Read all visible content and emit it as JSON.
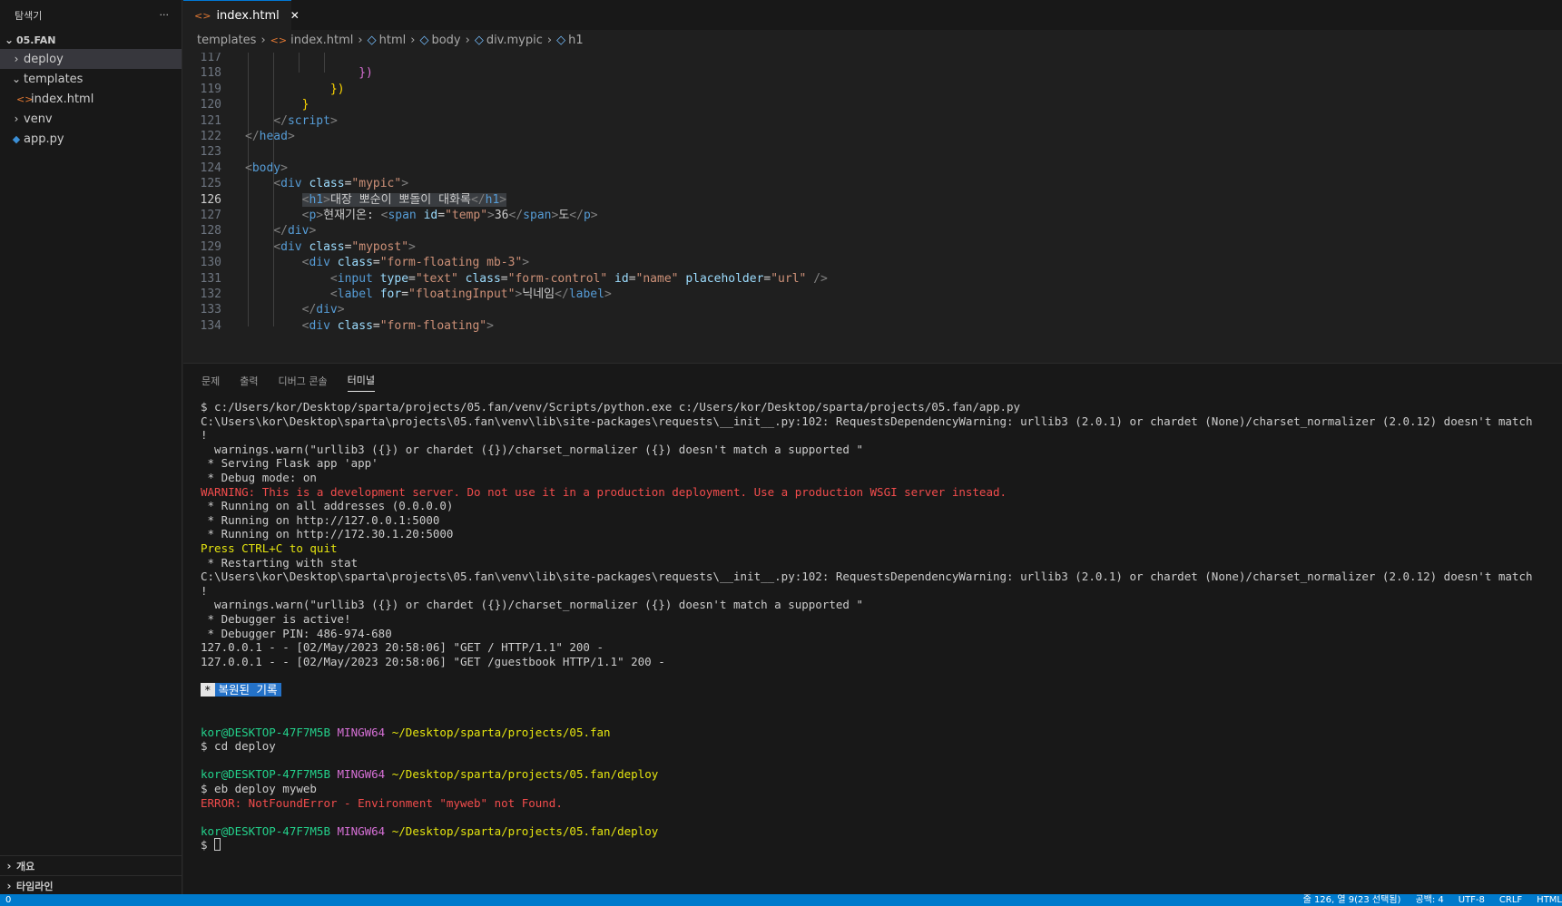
{
  "explorer": {
    "title": "탐색기",
    "more": "···",
    "project": "05.FAN",
    "items": [
      {
        "label": "deploy",
        "type": "folder",
        "icon": "chevron-right-icon"
      },
      {
        "label": "templates",
        "type": "folder-open",
        "icon": "chevron-down-icon"
      },
      {
        "label": "index.html",
        "type": "html-file",
        "icon": "html-file-icon"
      },
      {
        "label": "venv",
        "type": "folder",
        "icon": "chevron-right-icon"
      },
      {
        "label": "app.py",
        "type": "python-file",
        "icon": "python-file-icon"
      }
    ],
    "outline": "개요",
    "timeline": "타임라인"
  },
  "tab": {
    "label": "index.html",
    "close": "✕"
  },
  "breadcrumb": [
    "templates",
    "index.html",
    "html",
    "body",
    "div.mypic",
    "h1"
  ],
  "editor": {
    "lines": [
      {
        "n": "117",
        "html": ""
      },
      {
        "n": "118",
        "html": "                <span class='t-p'>})</span>"
      },
      {
        "n": "119",
        "html": "            <span class='t-y'>})</span>"
      },
      {
        "n": "120",
        "html": "        <span class='t-y'>}</span>"
      },
      {
        "n": "121",
        "html": "    <span class='t-br'>&lt;/</span><span class='t-tag'>script</span><span class='t-br'>&gt;</span>"
      },
      {
        "n": "122",
        "html": "<span class='t-br'>&lt;/</span><span class='t-tag'>head</span><span class='t-br'>&gt;</span>"
      },
      {
        "n": "123",
        "html": ""
      },
      {
        "n": "124",
        "html": "<span class='t-br'>&lt;</span><span class='t-tag'>body</span><span class='t-br'>&gt;</span>"
      },
      {
        "n": "125",
        "html": "    <span class='t-br'>&lt;</span><span class='t-tag'>div</span> <span class='t-attr'>class</span>=<span class='t-str'>\"mypic\"</span><span class='t-br'>&gt;</span>"
      },
      {
        "n": "126",
        "html": "        <span class='hl'><span class='t-br'>&lt;</span><span class='t-tag'>h1</span><span class='t-br'>&gt;</span>대장 뽀순이 뽀돌이 대화록<span class='t-br'>&lt;/</span><span class='t-tag'>h1</span><span class='t-br'>&gt;</span></span>"
      },
      {
        "n": "127",
        "html": "        <span class='t-br'>&lt;</span><span class='t-tag'>p</span><span class='t-br'>&gt;</span>현재기온: <span class='t-br'>&lt;</span><span class='t-tag'>span</span> <span class='t-attr'>id</span>=<span class='t-str'>\"temp\"</span><span class='t-br'>&gt;</span>36<span class='t-br'>&lt;/</span><span class='t-tag'>span</span><span class='t-br'>&gt;</span>도<span class='t-br'>&lt;/</span><span class='t-tag'>p</span><span class='t-br'>&gt;</span>"
      },
      {
        "n": "128",
        "html": "    <span class='t-br'>&lt;/</span><span class='t-tag'>div</span><span class='t-br'>&gt;</span>"
      },
      {
        "n": "129",
        "html": "    <span class='t-br'>&lt;</span><span class='t-tag'>div</span> <span class='t-attr'>class</span>=<span class='t-str'>\"mypost\"</span><span class='t-br'>&gt;</span>"
      },
      {
        "n": "130",
        "html": "        <span class='t-br'>&lt;</span><span class='t-tag'>div</span> <span class='t-attr'>class</span>=<span class='t-str'>\"form-floating mb-3\"</span><span class='t-br'>&gt;</span>"
      },
      {
        "n": "131",
        "html": "            <span class='t-br'>&lt;</span><span class='t-tag'>input</span> <span class='t-attr'>type</span>=<span class='t-str'>\"text\"</span> <span class='t-attr'>class</span>=<span class='t-str'>\"form-control\"</span> <span class='t-attr'>id</span>=<span class='t-str'>\"name\"</span> <span class='t-attr'>placeholder</span>=<span class='t-str'>\"url\"</span> <span class='t-br'>/&gt;</span>"
      },
      {
        "n": "132",
        "html": "            <span class='t-br'>&lt;</span><span class='t-tag'>label</span> <span class='t-attr'>for</span>=<span class='t-str'>\"floatingInput\"</span><span class='t-br'>&gt;</span>닉네임<span class='t-br'>&lt;/</span><span class='t-tag'>label</span><span class='t-br'>&gt;</span>"
      },
      {
        "n": "133",
        "html": "        <span class='t-br'>&lt;/</span><span class='t-tag'>div</span><span class='t-br'>&gt;</span>"
      },
      {
        "n": "134",
        "html": "        <span class='t-br'>&lt;</span><span class='t-tag'>div</span> <span class='t-attr'>class</span>=<span class='t-str'>\"form-floating\"</span><span class='t-br'>&gt;</span>"
      }
    ],
    "current_line": "126"
  },
  "panel": {
    "tabs": [
      "문제",
      "출력",
      "디버그 콘솔",
      "터미널"
    ],
    "active_tab": "터미널"
  },
  "terminal": [
    {
      "c": "",
      "t": "$ c:/Users/kor/Desktop/sparta/projects/05.fan/venv/Scripts/python.exe c:/Users/kor/Desktop/sparta/projects/05.fan/app.py"
    },
    {
      "c": "",
      "t": "C:\\Users\\kor\\Desktop\\sparta\\projects\\05.fan\\venv\\lib\\site-packages\\requests\\__init__.py:102: RequestsDependencyWarning: urllib3 (2.0.1) or chardet (None)/charset_normalizer (2.0.12) doesn't match"
    },
    {
      "c": "",
      "t": "!"
    },
    {
      "c": "",
      "t": "  warnings.warn(\"urllib3 ({}) or chardet ({})/charset_normalizer ({}) doesn't match a supported \""
    },
    {
      "c": "",
      "t": " * Serving Flask app 'app'"
    },
    {
      "c": "",
      "t": " * Debug mode: on"
    },
    {
      "c": "red",
      "t": "WARNING: This is a development server. Do not use it in a production deployment. Use a production WSGI server instead."
    },
    {
      "c": "",
      "t": " * Running on all addresses (0.0.0.0)"
    },
    {
      "c": "",
      "t": " * Running on http://127.0.0.1:5000"
    },
    {
      "c": "",
      "t": " * Running on http://172.30.1.20:5000"
    },
    {
      "c": "yel",
      "t": "Press CTRL+C to quit"
    },
    {
      "c": "",
      "t": " * Restarting with stat"
    },
    {
      "c": "",
      "t": "C:\\Users\\kor\\Desktop\\sparta\\projects\\05.fan\\venv\\lib\\site-packages\\requests\\__init__.py:102: RequestsDependencyWarning: urllib3 (2.0.1) or chardet (None)/charset_normalizer (2.0.12) doesn't match"
    },
    {
      "c": "",
      "t": "!"
    },
    {
      "c": "",
      "t": "  warnings.warn(\"urllib3 ({}) or chardet ({})/charset_normalizer ({}) doesn't match a supported \""
    },
    {
      "c": "",
      "t": " * Debugger is active!"
    },
    {
      "c": "",
      "t": " * Debugger PIN: 486-974-680"
    },
    {
      "c": "",
      "t": "127.0.0.1 - - [02/May/2023 20:58:06] \"GET / HTTP/1.1\" 200 -"
    },
    {
      "c": "",
      "t": "127.0.0.1 - - [02/May/2023 20:58:06] \"GET /guestbook HTTP/1.1\" 200 -"
    },
    {
      "c": "blank",
      "t": ""
    },
    {
      "c": "restored",
      "t": "복원된 기록",
      "star": "*"
    },
    {
      "c": "blank",
      "t": ""
    },
    {
      "c": "blank",
      "t": ""
    },
    {
      "c": "prompt",
      "user": "kor@DESKTOP-47F7M5B",
      "sys": "MINGW64",
      "path": "~/Desktop/sparta/projects/05.fan"
    },
    {
      "c": "",
      "t": "$ cd deploy"
    },
    {
      "c": "blank",
      "t": ""
    },
    {
      "c": "prompt",
      "user": "kor@DESKTOP-47F7M5B",
      "sys": "MINGW64",
      "path": "~/Desktop/sparta/projects/05.fan/deploy"
    },
    {
      "c": "",
      "t": "$ eb deploy myweb"
    },
    {
      "c": "red",
      "t": "ERROR: NotFoundError - Environment \"myweb\" not Found."
    },
    {
      "c": "blank",
      "t": ""
    },
    {
      "c": "prompt",
      "user": "kor@DESKTOP-47F7M5B",
      "sys": "MINGW64",
      "path": "~/Desktop/sparta/projects/05.fan/deploy"
    },
    {
      "c": "input",
      "t": "$ "
    }
  ],
  "status": {
    "left": "0",
    "right": [
      "줄 126, 열 9(23 선택됨)",
      "공백: 4",
      "UTF-8",
      "CRLF",
      "HTML"
    ]
  }
}
